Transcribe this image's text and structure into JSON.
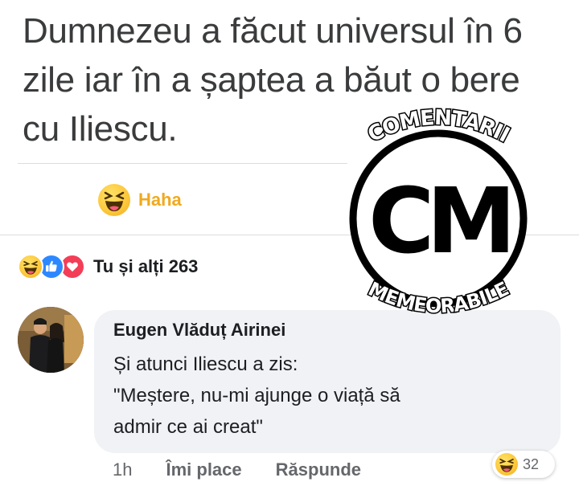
{
  "post": {
    "lines": [
      "Dumnezeu a făcut universul în 6",
      "zile iar în a șaptea a băut o bere",
      "cu Iliescu."
    ]
  },
  "reaction_bar": {
    "haha_label": "Haha"
  },
  "reactions_summary": {
    "text": "Tu și alți 263",
    "icons": [
      "haha-icon",
      "like-icon",
      "love-icon"
    ]
  },
  "comment": {
    "author": "Eugen Vlăduț Airinei",
    "lines": [
      "Și atunci Iliescu a zis:",
      "\"Meștere, nu-mi ajunge o viață să",
      "admir ce ai creat\""
    ],
    "time": "1h",
    "like_action": "Îmi place",
    "reply_action": "Răspunde",
    "reaction_count": "32"
  },
  "watermark": {
    "top_text": "COMENTARII",
    "logo": "CM",
    "bottom_text": "MEMEORABILE"
  },
  "colors": {
    "haha_yellow": "#f0a91e",
    "like_blue": "#2d88ff",
    "love_red": "#f33e58",
    "bubble_bg": "#f0f2f5"
  }
}
